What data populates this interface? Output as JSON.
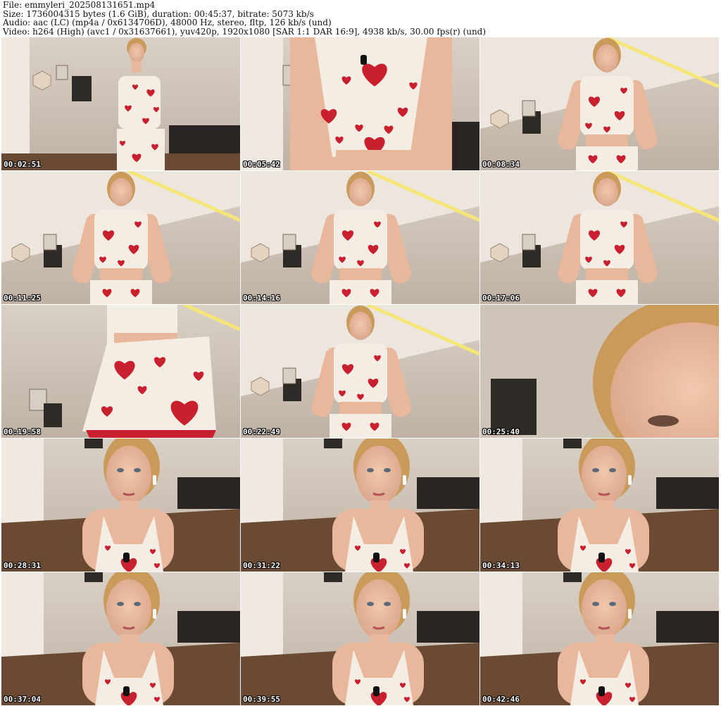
{
  "header": {
    "line1": "File: emmyleri_202508131651.mp4",
    "line2": "Size: 1736004315 bytes (1.6 GiB), duration: 00:45:37, bitrate: 5073 kb/s",
    "line3": "Audio: aac (LC) (mp4a / 0x6134706D), 48000 Hz, stereo, fltp, 126 kb/s (und)",
    "line4": "Video: h264 (High) (avc1 / 0x31637661), yuv420p, 1920x1080 [SAR 1:1 DAR 16:9], 4938 kb/s, 30.00 fps(r) (und)"
  },
  "thumbnails": [
    {
      "time": "00:02:51",
      "scene": "room-full"
    },
    {
      "time": "00:05:42",
      "scene": "torso-close"
    },
    {
      "time": "00:08:34",
      "scene": "low-angle-right"
    },
    {
      "time": "00:11:25",
      "scene": "side-left"
    },
    {
      "time": "00:14:16",
      "scene": "low-angle-center"
    },
    {
      "time": "00:17:06",
      "scene": "low-angle-right"
    },
    {
      "time": "00:19:58",
      "scene": "skirt-close"
    },
    {
      "time": "00:22:49",
      "scene": "low-angle-center"
    },
    {
      "time": "00:25:40",
      "scene": "face-edge"
    },
    {
      "time": "00:28:31",
      "scene": "face-left"
    },
    {
      "time": "00:31:22",
      "scene": "face-center"
    },
    {
      "time": "00:34:13",
      "scene": "face-right"
    },
    {
      "time": "00:37:04",
      "scene": "face-left"
    },
    {
      "time": "00:39:55",
      "scene": "face-center"
    },
    {
      "time": "00:42:46",
      "scene": "face-right"
    }
  ],
  "colors": {
    "wall": "#e7ded4",
    "floor": "#6b4a34",
    "skin": "#e8b79c",
    "hair": "#c99a5a",
    "top": "#f4ede4",
    "heart": "#c8202e",
    "timestamp": "#ffffff"
  }
}
